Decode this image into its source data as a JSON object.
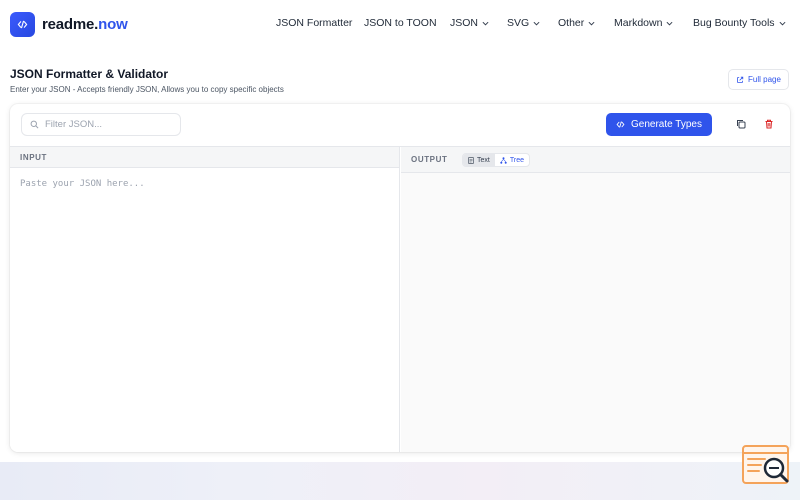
{
  "brand": {
    "name": "readme.",
    "tld": "now",
    "accent": "#2f54eb"
  },
  "nav": [
    {
      "label": "JSON Formatter",
      "dropdown": false
    },
    {
      "label": "JSON to TOON",
      "dropdown": false
    },
    {
      "label": "JSON",
      "dropdown": true
    },
    {
      "label": "SVG",
      "dropdown": true
    },
    {
      "label": "Other",
      "dropdown": true
    },
    {
      "label": "Markdown",
      "dropdown": true
    },
    {
      "label": "Bug Bounty Tools",
      "dropdown": true
    }
  ],
  "page": {
    "title": "JSON Formatter & Validator",
    "subtitle": "Enter your JSON - Accepts friendly JSON, Allows you to copy specific objects",
    "full_page_label": "Full page"
  },
  "toolbar": {
    "filter_placeholder": "Filter JSON...",
    "generate_label": "Generate Types",
    "copy_icon": "copy-icon",
    "delete_icon": "trash-icon"
  },
  "input_pane": {
    "label": "INPUT",
    "placeholder": "Paste your JSON here..."
  },
  "output_pane": {
    "label": "OUTPUT",
    "view_text_label": "Text",
    "view_tree_label": "Tree"
  },
  "colors": {
    "primary": "#2f54eb",
    "danger": "#dc2626",
    "widget": "#f4a35a"
  }
}
